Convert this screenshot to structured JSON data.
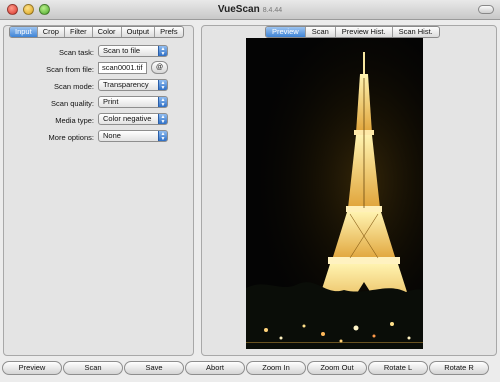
{
  "window": {
    "title": "VueScan",
    "version": "8.4.44"
  },
  "left_tabs": [
    "Input",
    "Crop",
    "Filter",
    "Color",
    "Output",
    "Prefs"
  ],
  "form": {
    "scan_task": {
      "label": "Scan task:",
      "value": "Scan to file"
    },
    "scan_from_file": {
      "label": "Scan from file:",
      "value": "scan0001.tif",
      "button": "@"
    },
    "scan_mode": {
      "label": "Scan mode:",
      "value": "Transparency"
    },
    "scan_quality": {
      "label": "Scan quality:",
      "value": "Print"
    },
    "media_type": {
      "label": "Media type:",
      "value": "Color negative"
    },
    "more_options": {
      "label": "More options:",
      "value": "None"
    }
  },
  "right_tabs": [
    "Preview",
    "Scan",
    "Preview Hist.",
    "Scan Hist."
  ],
  "preview": {
    "subject": "eiffel-tower-night-photo"
  },
  "buttons": [
    "Preview",
    "Scan",
    "Save",
    "Abort",
    "Zoom In",
    "Zoom Out",
    "Rotate L",
    "Rotate R"
  ],
  "colors": {
    "accent": "#3f84d6",
    "window_bg": "#ececec",
    "panel_bg": "#e4e4e4"
  }
}
